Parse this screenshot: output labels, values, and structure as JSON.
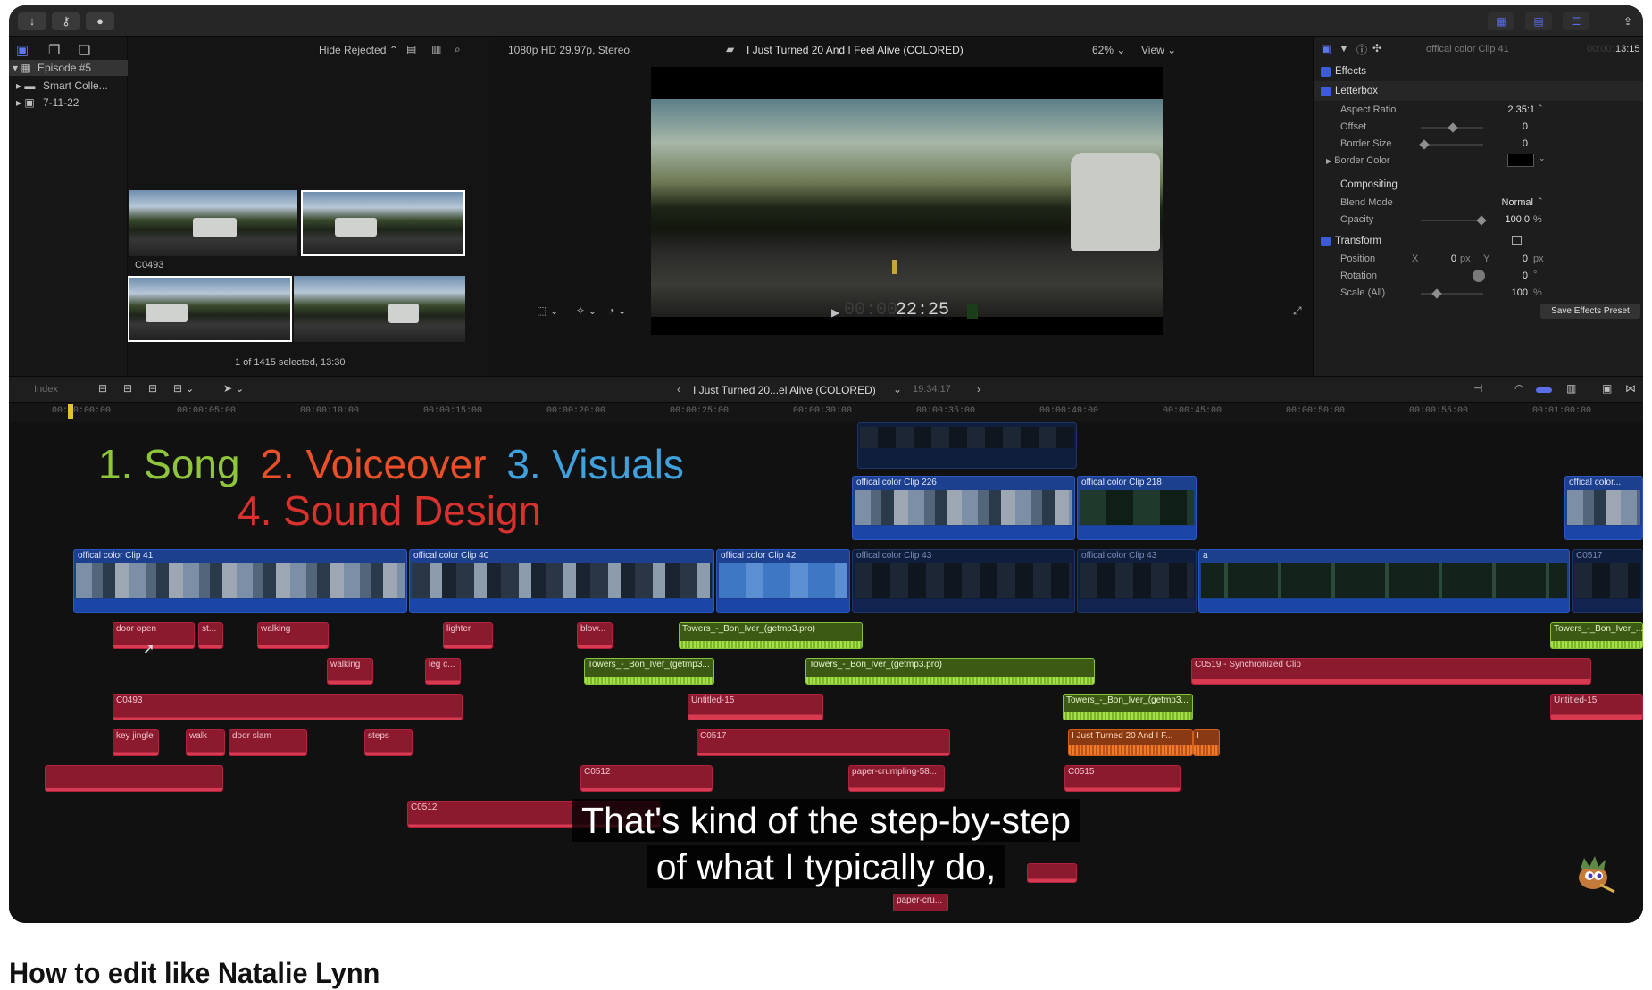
{
  "toolbar": {
    "left_icons": [
      "download-icon",
      "key-icon",
      "circle-check-icon"
    ],
    "right_icons": [
      "grid-icon",
      "filmstrip-icon",
      "sliders-icon",
      "share-icon"
    ]
  },
  "library": {
    "items": [
      {
        "label": "Episode #5",
        "expanded": true
      },
      {
        "label": "Smart Colle...",
        "expanded": false
      },
      {
        "label": "7-11-22",
        "expanded": false
      }
    ]
  },
  "browser": {
    "filter_label": "Hide Rejected",
    "clip_name": "C0493",
    "status": "1 of 1415 selected, 13:30"
  },
  "viewer": {
    "format": "1080p HD 29.97p, Stereo",
    "title": "I Just Turned 20 And I Feel Alive (COLORED)",
    "zoom": "62%",
    "view_label": "View",
    "timecode_dim": "00:00:",
    "timecode": "22:25"
  },
  "inspector": {
    "clip_name": "offical color Clip 41",
    "duration_dim": "00:00:",
    "duration": "13:15",
    "effects_label": "Effects",
    "letterbox_label": "Letterbox",
    "aspect_ratio_label": "Aspect Ratio",
    "aspect_ratio_value": "2.35:1",
    "offset_label": "Offset",
    "offset_value": "0",
    "border_size_label": "Border Size",
    "border_size_value": "0",
    "border_color_label": "Border Color",
    "compositing_label": "Compositing",
    "blend_mode_label": "Blend Mode",
    "blend_mode_value": "Normal",
    "opacity_label": "Opacity",
    "opacity_value": "100.0",
    "opacity_unit": "%",
    "transform_label": "Transform",
    "position_label": "Position",
    "pos_x_axis": "X",
    "pos_x_value": "0",
    "pos_y_axis": "Y",
    "pos_y_value": "0",
    "px_unit": "px",
    "rotation_label": "Rotation",
    "rotation_value": "0",
    "rotation_unit": "°",
    "scale_label": "Scale (All)",
    "scale_value": "100",
    "scale_unit": "%",
    "save_preset_label": "Save Effects Preset"
  },
  "timeline": {
    "index_label": "Index",
    "project_name": "I Just Turned 20...el Alive (COLORED)",
    "duration": "19:34:17",
    "ruler_ticks": [
      "00:00:00:00",
      "00:00:05:00",
      "00:00:10:00",
      "00:00:15:00",
      "00:00:20:00",
      "00:00:25:00",
      "00:00:30:00",
      "00:00:35:00",
      "00:00:40:00",
      "00:00:45:00",
      "00:00:50:00",
      "00:00:55:00",
      "00:01:00:00"
    ],
    "overlay": {
      "song": "1. Song",
      "voiceover": "2. Voiceover",
      "visuals": "3. Visuals",
      "sound_design": "4. Sound Design",
      "song_color": "#8fc53a",
      "voiceover_color": "#e8502a",
      "visuals_color": "#3fa2de",
      "sound_design_color": "#d8322f"
    },
    "video_clips": {
      "c41": "offical color Clip 41",
      "c40": "offical color Clip 40",
      "c42": "offical color Clip 42",
      "c43a": "offical color Clip 43",
      "c43b": "offical color Clip 43",
      "a": "a",
      "c0517": "C0517",
      "c226": "offical color Clip 226",
      "c218": "offical color Clip 218",
      "coff": "offical color..."
    },
    "audio_clips": {
      "door_open": "door open",
      "st": "st...",
      "walking1": "walking",
      "lighter": "lighter",
      "blow": "blow...",
      "towers1": "Towers_-_Bon_Iver_(getmp3.pro)",
      "towers_r": "Towers_-_Bon_Iver_...",
      "walking2": "walking",
      "legc": "leg c...",
      "towers2": "Towers_-_Bon_Iver_(getmp3...",
      "towers3": "Towers_-_Bon_Iver_(getmp3.pro)",
      "c0519": "C0519 - Synchronized Clip",
      "c0493": "C0493",
      "untitled1": "Untitled-15",
      "towers4": "Towers_-_Bon_Iver_(getmp3...",
      "untitled2": "Untitled-15",
      "key_jingle": "key jingle",
      "walk": "walk",
      "door_slam": "door slam",
      "steps": "steps",
      "c0517": "C0517",
      "ijust": "I Just Turned 20 And I F...",
      "ijust2": "I",
      "c0512a": "C0512",
      "paper1": "paper-crumpling-58...",
      "c0515": "C0515",
      "c0512b": "C0512",
      "paper2": "paper-cru..."
    },
    "caption_line1": "That's kind of the step-by-step",
    "caption_line2": "of what I typically do,"
  },
  "video_title": "How to edit like Natalie Lynn"
}
